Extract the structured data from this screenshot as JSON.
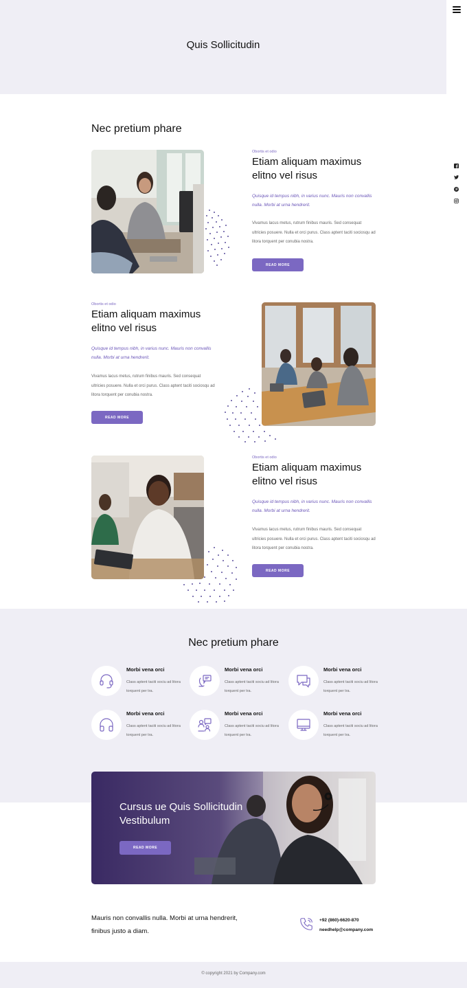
{
  "hero": {
    "title": "Quis Sollicitudin"
  },
  "nav": {
    "menu_icon": "hamburger-menu-icon",
    "social": [
      "facebook-icon",
      "twitter-icon",
      "pinterest-icon",
      "instagram-icon"
    ]
  },
  "features": {
    "heading": "Nec pretium phare",
    "items": [
      {
        "tag": "Obortis et odio",
        "title": "Etiam aliquam maximus elitno vel risus",
        "quote": "Quisque id tempus nibh, in varius nunc. Mauris non convallis nulla. Morbi at urna hendrerit.",
        "body": "Vivamus lacus metus, rutrum finibus mauris. Sed consequat ultricies posuere. Nulla et orci purus. Class aptent taciti sociosqu ad litora torquent per conubia nostra.",
        "button": "READ MORE"
      },
      {
        "tag": "Obortis et odio",
        "title": "Etiam aliquam maximus elitno vel risus",
        "quote": "Quisque id tempus nibh, in varius nunc. Mauris non convallis nulla. Morbi at urna hendrerit.",
        "body": "Vivamus lacus metus, rutrum finibus mauris. Sed consequat ultricies posuere. Nulla et orci purus. Class aptent taciti sociosqu ad litora torquent per conubia nostra.",
        "button": "READ MORE"
      },
      {
        "tag": "Obortis et odio",
        "title": "Etiam aliquam maximus elitno vel risus",
        "quote": "Quisque id tempus nibh, in varius nunc. Mauris non convallis nulla. Morbi at urna hendrerit.",
        "body": "Vivamus lacus metus, rutrum finibus mauris. Sed consequat ultricies posuere. Nulla et orci purus. Class aptent taciti sociosqu ad litora torquent per conubia nostra.",
        "button": "READ MORE"
      }
    ]
  },
  "services": {
    "heading": "Nec pretium phare",
    "items": [
      {
        "icon": "headset-icon",
        "title": "Morbi vena orci",
        "desc": "Class aptent taciti sociu ad litora torquent per tra."
      },
      {
        "icon": "support-chat-icon",
        "title": "Morbi vena orci",
        "desc": "Class aptent taciti sociu ad litora torquent per tra."
      },
      {
        "icon": "chat-bubbles-icon",
        "title": "Morbi vena orci",
        "desc": "Class aptent taciti sociu ad litora torquent per tra."
      },
      {
        "icon": "headphones-icon",
        "title": "Morbi vena orci",
        "desc": "Class aptent taciti sociu ad litora torquent per tra."
      },
      {
        "icon": "team-meeting-icon",
        "title": "Morbi vena orci",
        "desc": "Class aptent taciti sociu ad litora torquent per tra."
      },
      {
        "icon": "monitor-icon",
        "title": "Morbi vena orci",
        "desc": "Class aptent taciti sociu ad litora torquent per tra."
      }
    ]
  },
  "banner": {
    "title": "Cursus ue Quis Sollicitudin Vestibulum",
    "button": "READ MORE"
  },
  "contact": {
    "text": "Mauris non convallis nulla. Morbi at urna hendrerit, finibus justo a diam.",
    "phone": "+92 (860)-6620-870",
    "email": "needhelp@company.com",
    "icon": "phone-icon"
  },
  "footer": {
    "copyright": "© copyright 2021 by Company.com"
  },
  "colors": {
    "accent": "#7b68c2",
    "light_bg": "#efeef5",
    "text": "#111111"
  }
}
